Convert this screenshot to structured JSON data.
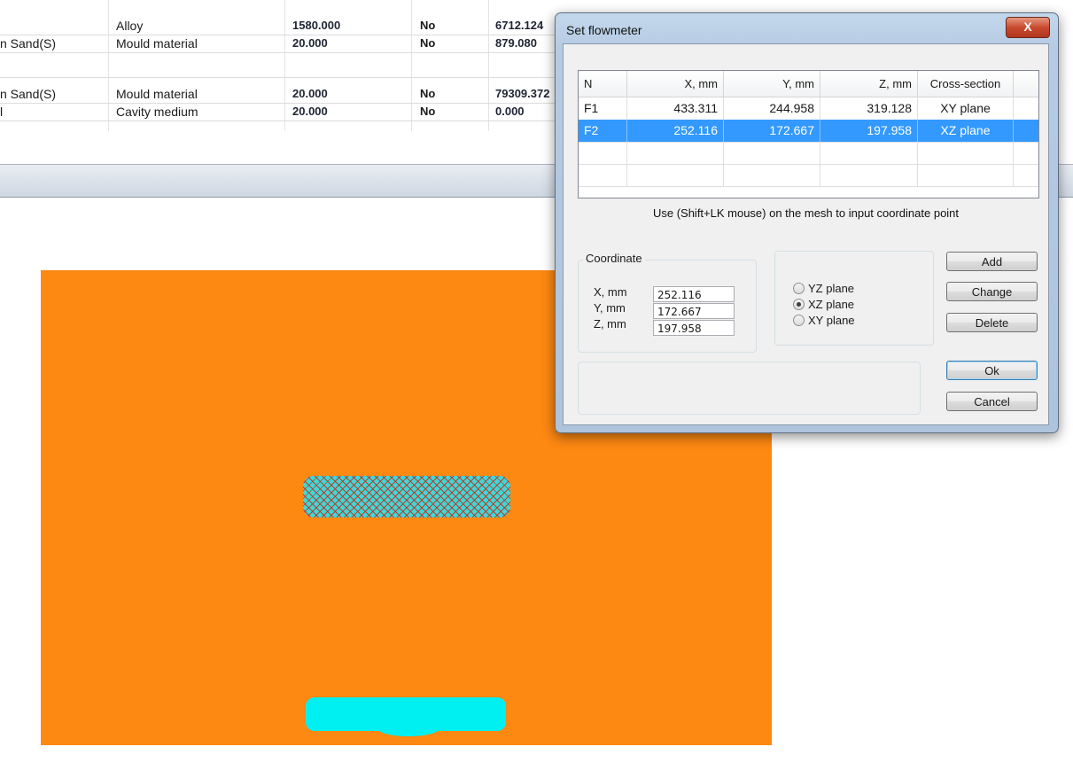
{
  "materials_table": {
    "rows": [
      {
        "name": "",
        "type": "Alloy",
        "temperature": "1580.000",
        "flag": "No",
        "value": "6712.124"
      },
      {
        "name": "n Sand(S)",
        "type": "Mould material",
        "temperature": "20.000",
        "flag": "No",
        "value": "879.080"
      },
      {
        "name": "",
        "type": "",
        "temperature": "",
        "flag": "",
        "value": ""
      },
      {
        "name": "n Sand(S)",
        "type": "Mould material",
        "temperature": "20.000",
        "flag": "No",
        "value": "79309.372"
      },
      {
        "name": "l",
        "type": "Cavity medium",
        "temperature": "20.000",
        "flag": "No",
        "value": "0.000"
      }
    ]
  },
  "viewport": {
    "background_color": "#fd8812",
    "part_color": "#00f0f2"
  },
  "dialog": {
    "title": "Set flowmeter",
    "close_label": "X",
    "table": {
      "headers": [
        "N",
        "X, mm",
        "Y, mm",
        "Z, mm",
        "Cross-section"
      ],
      "rows": [
        {
          "n": "F1",
          "x": "433.311",
          "y": "244.958",
          "z": "319.128",
          "section": "XY plane"
        },
        {
          "n": "F2",
          "x": "252.116",
          "y": "172.667",
          "z": "197.958",
          "section": "XZ plane"
        }
      ],
      "selected_row": "F2"
    },
    "hint": "Use (Shift+LK mouse) on the mesh to input coordinate point",
    "coordinate": {
      "label": "Coordinate",
      "x_label": "X, mm",
      "x_value": "252.116",
      "y_label": "Y, mm",
      "y_value": "172.667",
      "z_label": "Z, mm",
      "z_value": "197.958"
    },
    "plane": {
      "options": [
        "YZ plane",
        "XZ plane",
        "XY plane"
      ],
      "selected": "XZ plane"
    },
    "buttons": {
      "add": "Add",
      "change": "Change",
      "delete": "Delete",
      "ok": "Ok",
      "cancel": "Cancel"
    },
    "selection_color": "#3399ff"
  }
}
